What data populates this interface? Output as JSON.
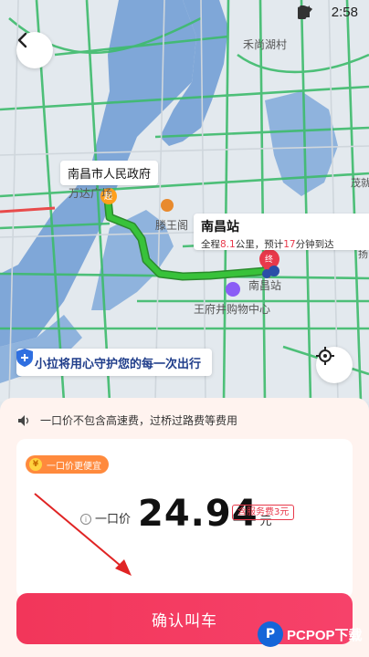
{
  "status_bar": {
    "time": "2:58",
    "icons": [
      "location-icon",
      "alarm-icon",
      "wifi-icon",
      "signal-icon",
      "battery-icon"
    ]
  },
  "map": {
    "labels": {
      "top_village": "禾尚湖村",
      "wanda": "万达广场",
      "tengwang": "滕王阁",
      "mall": "王府井购物中心",
      "station_small": "南昌站",
      "right_edge_1": "茂就",
      "right_edge_2": "扬"
    },
    "start_marker": "起",
    "end_marker": "终",
    "origin_label": "南昌市人民政府",
    "destination": {
      "name": "南昌站",
      "eta_prefix": "全程",
      "distance": "8.1",
      "eta_middle": "公里，预计",
      "minutes": "17",
      "eta_suffix": "分钟到达"
    },
    "safety_banner": "小拉将用心守护您的每一次出行"
  },
  "sheet": {
    "notice": "一口价不包含高速费，过桥过路费等费用",
    "badge": {
      "coin": "¥",
      "label": "一口价更便宜"
    },
    "price": {
      "label": "一口价",
      "value": "24.94",
      "unit": "元",
      "fee_tag": "含服务费3元"
    },
    "confirm_button": "确认叫车"
  },
  "watermark": {
    "logo": "P",
    "text": "PCPOP下载"
  },
  "colors": {
    "primary": "#f2365a",
    "route": "#2ea52f",
    "road": "#3dbb6c",
    "water": "#7fa7d8",
    "brand_blue": "#1f3d8a"
  }
}
